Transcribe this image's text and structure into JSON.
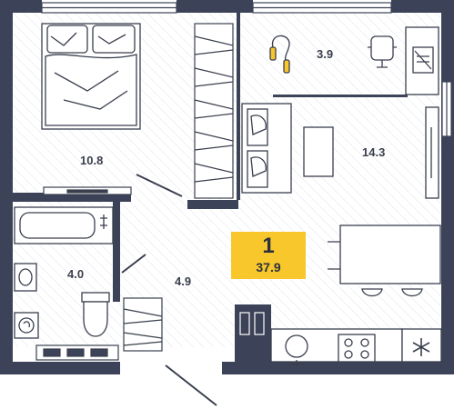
{
  "apartment": {
    "rooms": "1",
    "total_area": "37.9"
  },
  "areas": {
    "bedroom": "10.8",
    "balcony": "3.9",
    "living_kitchen": "14.3",
    "bathroom": "4.0",
    "hallway": "4.9"
  },
  "colors": {
    "wall": "#3c4257",
    "badge": "#f7c72b",
    "line": "#3a3f4d"
  },
  "icons": [
    "bed-icon",
    "jump-rope-icon",
    "desk-chair-icon",
    "laptop-icon",
    "sofa-icon",
    "table-icon",
    "bathtub-icon",
    "sink-icon",
    "toilet-icon",
    "washing-machine-icon",
    "stove-icon",
    "snowflake-icon",
    "tv-icon",
    "wardrobe-icon"
  ]
}
